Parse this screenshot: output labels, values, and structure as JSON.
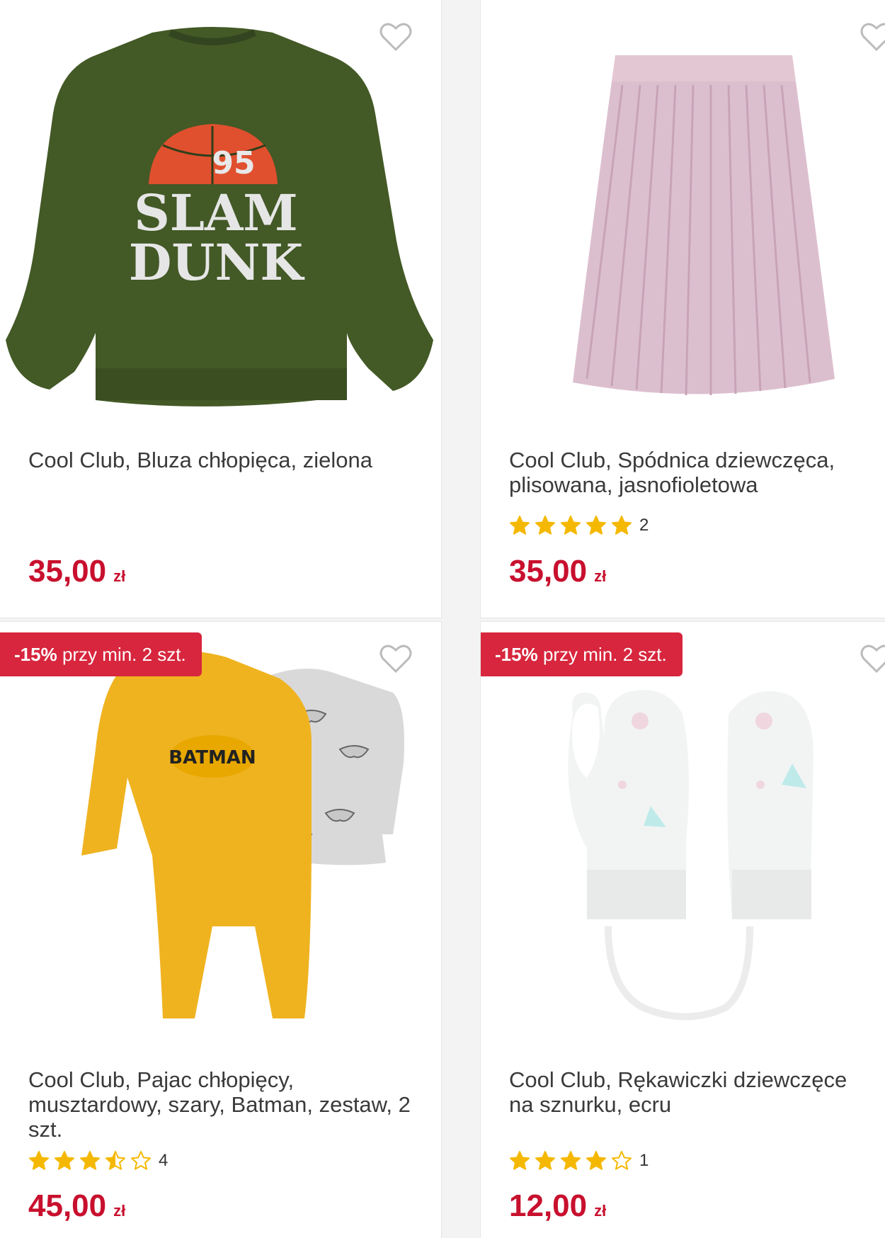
{
  "products": [
    {
      "title": "Cool Club, Bluza chłopięca, zielona",
      "price": "35,00",
      "currency": "zł",
      "image": {
        "print_number": "95",
        "print_line1": "SLAM",
        "print_line2": "DUNK"
      }
    },
    {
      "title": "Cool Club, Spódnica dziewczęca, plisowana, jasnofioletowa",
      "rating": 5,
      "rating_count": "2",
      "price": "35,00",
      "currency": "zł"
    },
    {
      "badge_discount": "-15%",
      "badge_text": "przy min. 2 szt.",
      "title": "Cool Club, Pajac chłopięcy, musztardowy, szary, Batman, zestaw, 2 szt.",
      "rating": 3.5,
      "rating_count": "4",
      "price": "45,00",
      "currency": "zł",
      "image": {
        "print_text": "BATMAN"
      }
    },
    {
      "badge_discount": "-15%",
      "badge_text": "przy min. 2 szt.",
      "title": "Cool Club, Rękawiczki dziewczęce na sznurku, ecru",
      "rating": 4,
      "rating_count": "1",
      "price": "12,00",
      "currency": "zł"
    }
  ],
  "icons": {
    "wishlist": "heart-outline-icon",
    "star_full": "star-filled-icon",
    "star_empty": "star-outline-icon"
  },
  "colors": {
    "price": "#c8102e",
    "badge": "#d7263d",
    "star": "#f5b800"
  }
}
